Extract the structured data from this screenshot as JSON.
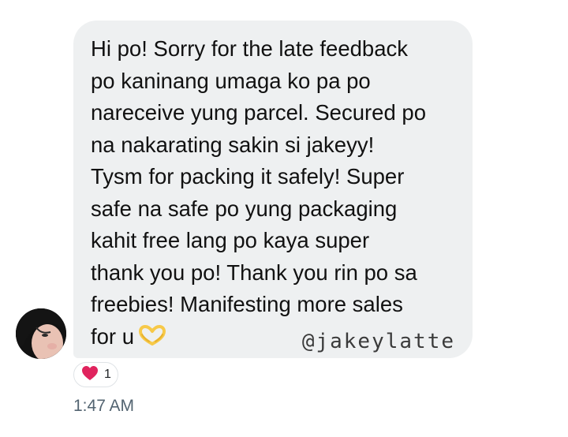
{
  "message": {
    "lines": [
      "Hi po! Sorry for the late feedback",
      "po kaninang umaga ko pa po",
      "nareceive yung parcel. Secured po",
      "na nakarating sakin si jakeyy!",
      "Tysm for packing it safely! Super",
      "safe na safe po yung packaging",
      "kahit free lang po kaya super",
      "thank you po! Thank you rin po sa",
      "freebies! Manifesting more sales",
      "for u"
    ],
    "emoji": "heart-hands-icon"
  },
  "watermark": "@jakeylatte",
  "reaction": {
    "icon": "red-heart-icon",
    "count": "1"
  },
  "timestamp": "1:47 AM",
  "colors": {
    "bubble_bg": "#eef0f1",
    "text": "#111111",
    "timestamp": "#536471",
    "heart": "#e0245e",
    "emoji_yellow": "#f7c948"
  }
}
